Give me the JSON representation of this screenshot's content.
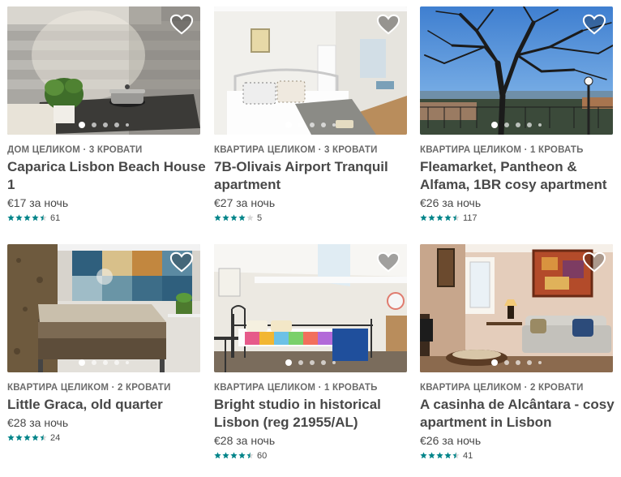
{
  "colors": {
    "star_filled": "#008489",
    "star_empty": "#d8d8d8",
    "text": "#484848",
    "meta": "#6b6b6b"
  },
  "listings": [
    {
      "type": "ДОМ ЦЕЛИКОМ · 3 КРОВАТИ",
      "title": "Caparica Lisbon Beach House 1",
      "price": "€17 за ночь",
      "rating": 4.5,
      "reviews": "61",
      "photo": "kitchen-with-plant",
      "active_dot": 1
    },
    {
      "type": "КВАРТИРА ЦЕЛИКОМ · 3 КРОВАТИ",
      "title": "7B-Olivais Airport Tranquil apartment",
      "price": "€27 за ночь",
      "rating": 4,
      "reviews": "5",
      "photo": "white-bedroom",
      "active_dot": 1
    },
    {
      "type": "КВАРТИРА ЦЕЛИКОМ · 1 КРОВАТЬ",
      "title": "Fleamarket, Pantheon & Alfama, 1BR cosy apartment",
      "price": "€26 за ночь",
      "rating": 4.5,
      "reviews": "117",
      "photo": "tree-and-view",
      "active_dot": 1
    },
    {
      "type": "КВАРТИРА ЦЕЛИКОМ · 2 КРОВАТИ",
      "title": "Little Graca, old quarter",
      "price": "€28 за ночь",
      "rating": 4.5,
      "reviews": "24",
      "photo": "tiled-bedroom",
      "active_dot": 1
    },
    {
      "type": "КВАРТИРА ЦЕЛИКОМ · 1 КРОВАТЬ",
      "title": "Bright studio in historical Lisbon (reg 21955/AL)",
      "price": "€28 за ночь",
      "rating": 4.5,
      "reviews": "60",
      "photo": "attic-studio",
      "active_dot": 1
    },
    {
      "type": "КВАРТИРА ЦЕЛИКОМ · 2 КРОВАТИ",
      "title": "A casinha de Alcântara - cosy apartment in Lisbon",
      "price": "€26 за ночь",
      "rating": 4.5,
      "reviews": "41",
      "photo": "living-room-sofa",
      "active_dot": 1
    }
  ]
}
